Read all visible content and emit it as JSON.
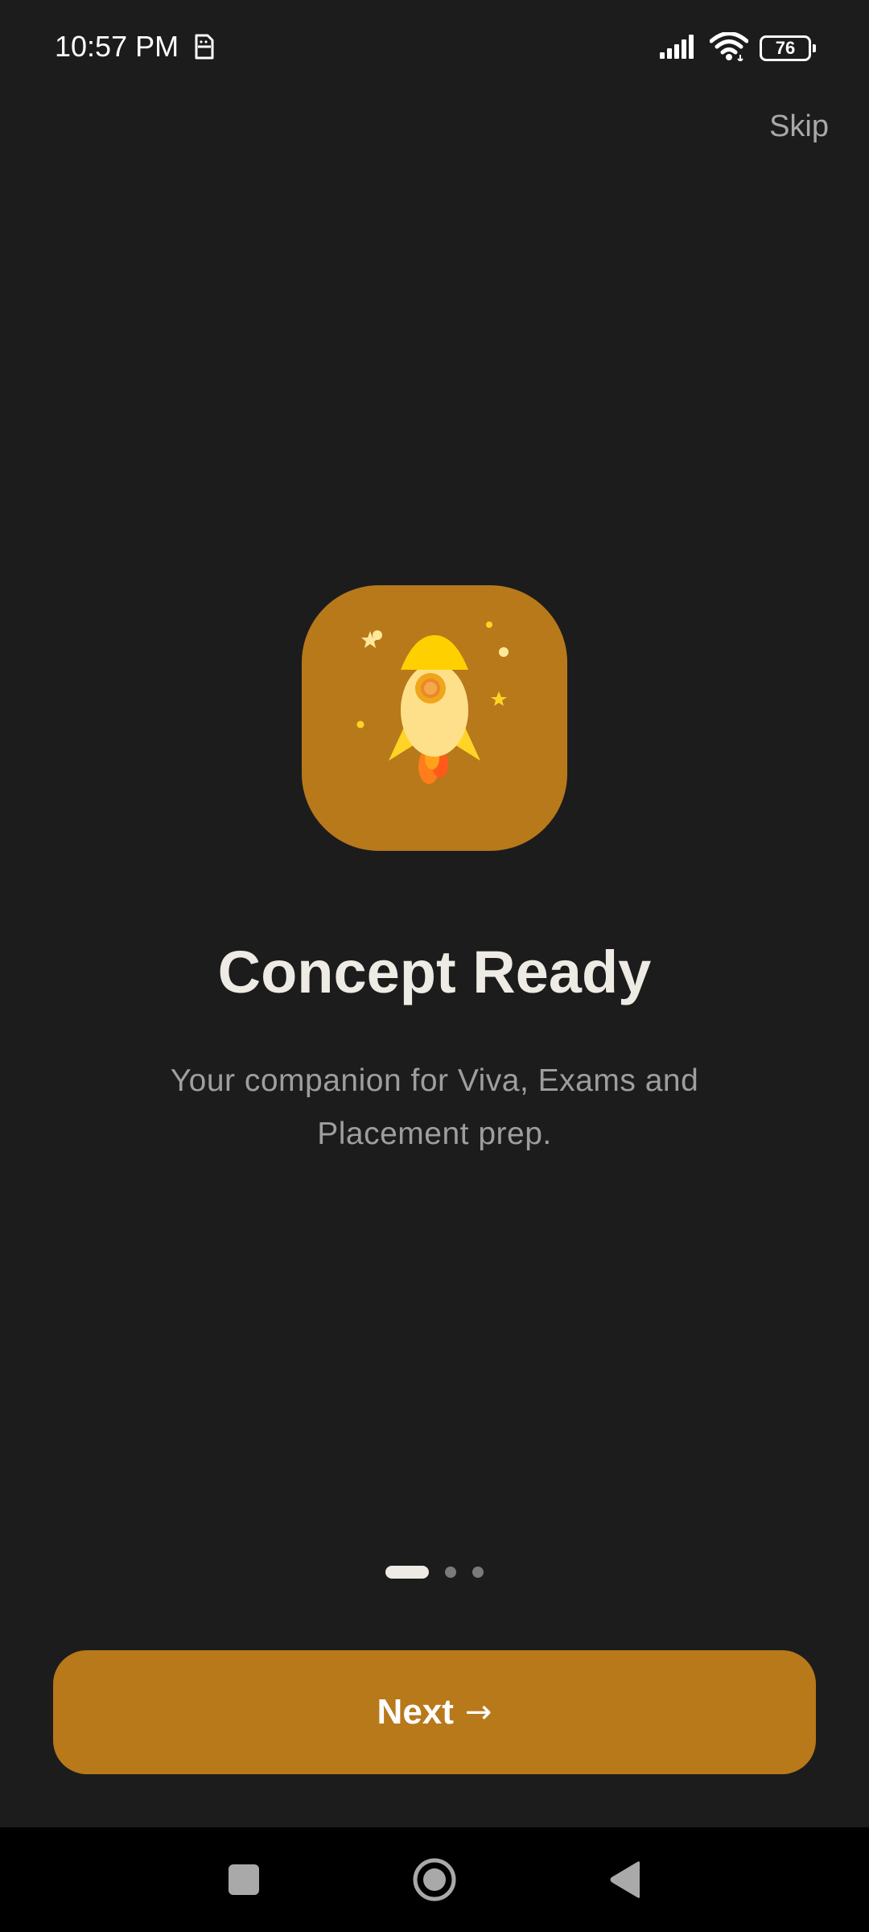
{
  "status_bar": {
    "time": "10:57 PM",
    "battery": "76"
  },
  "header": {
    "skip_label": "Skip"
  },
  "onboarding": {
    "icon": "rocket-icon",
    "title": "Concept Ready",
    "subtitle": "Your companion for Viva, Exams and Placement prep.",
    "page_count": 3,
    "current_page": 1
  },
  "footer": {
    "next_label": "Next",
    "next_arrow": "→"
  },
  "colors": {
    "background": "#1c1c1c",
    "accent": "#b8791b",
    "title": "#eeeae4",
    "subtitle": "#9e9e9e"
  }
}
